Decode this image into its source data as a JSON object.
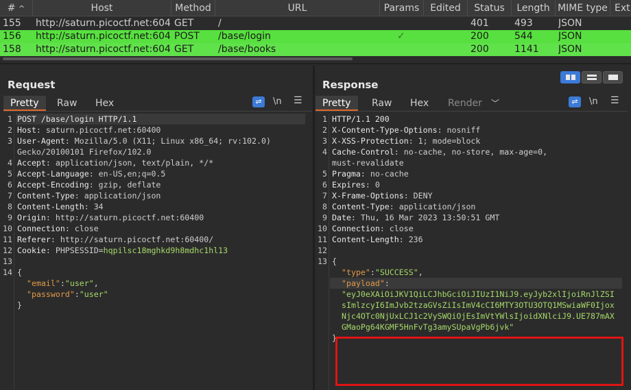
{
  "table": {
    "headers": [
      "#",
      "Host",
      "Method",
      "URL",
      "Params",
      "Edited",
      "Status",
      "Length",
      "MIME type",
      "Ext"
    ],
    "sort_indicator": "^",
    "rows": [
      {
        "num": "155",
        "host": "http://saturn.picoctf.net:604...",
        "method": "GET",
        "url": "/",
        "params": "",
        "status": "401",
        "length": "493",
        "mime": "JSON"
      },
      {
        "num": "156",
        "host": "http://saturn.picoctf.net:604...",
        "method": "POST",
        "url": "/base/login",
        "params": "✓",
        "status": "200",
        "length": "544",
        "mime": "JSON"
      },
      {
        "num": "158",
        "host": "http://saturn.picoctf.net:604...",
        "method": "GET",
        "url": "/base/books",
        "params": "",
        "status": "200",
        "length": "1141",
        "mime": "JSON"
      }
    ]
  },
  "request": {
    "title": "Request",
    "tabs": [
      "Pretty",
      "Raw",
      "Hex"
    ],
    "tool_newline": "\\n",
    "lines": [
      {
        "n": "1",
        "k": "POST /base/login HTTP/1.1",
        "v": ""
      },
      {
        "n": "2",
        "k": "Host",
        "v": ": saturn.picoctf.net:60400"
      },
      {
        "n": "3",
        "k": "User-Agent",
        "v": ": Mozilla/5.0 (X11; Linux x86_64; rv:102.0)"
      },
      {
        "n": "",
        "k": "",
        "v": "Gecko/20100101 Firefox/102.0"
      },
      {
        "n": "4",
        "k": "Accept",
        "v": ": application/json, text/plain, */*"
      },
      {
        "n": "5",
        "k": "Accept-Language",
        "v": ": en-US,en;q=0.5"
      },
      {
        "n": "6",
        "k": "Accept-Encoding",
        "v": ": gzip, deflate"
      },
      {
        "n": "7",
        "k": "Content-Type",
        "v": ": application/json"
      },
      {
        "n": "8",
        "k": "Content-Length",
        "v": ": 34"
      },
      {
        "n": "9",
        "k": "Origin",
        "v": ": http://saturn.picoctf.net:60400"
      },
      {
        "n": "10",
        "k": "Connection",
        "v": ": close"
      },
      {
        "n": "11",
        "k": "Referer",
        "v": ": http://saturn.picoctf.net:60400/"
      },
      {
        "n": "12",
        "k": "Cookie",
        "v": ": PHPSESSID="
      }
    ],
    "cookie_value": "hqpilsc18mghkd9h8mdhc1hl13",
    "line13": "13",
    "line14": "14",
    "brace_open": "{",
    "brace_close": "}",
    "json": [
      {
        "k": "\"email\"",
        "sep": ":",
        "v": "\"user\"",
        "end": ","
      },
      {
        "k": "\"password\"",
        "sep": ":",
        "v": "\"user\"",
        "end": ""
      }
    ]
  },
  "response": {
    "title": "Response",
    "tabs": [
      "Pretty",
      "Raw",
      "Hex",
      "Render"
    ],
    "tool_newline": "\\n",
    "lines": [
      {
        "n": "1",
        "k": "HTTP/1.1 200",
        "v": ""
      },
      {
        "n": "2",
        "k": "X-Content-Type-Options",
        "v": ": nosniff"
      },
      {
        "n": "3",
        "k": "X-XSS-Protection",
        "v": ": 1; mode=block"
      },
      {
        "n": "4",
        "k": "Cache-Control",
        "v": ": no-cache, no-store, max-age=0,"
      },
      {
        "n": "",
        "k": "",
        "v": "must-revalidate"
      },
      {
        "n": "5",
        "k": "Pragma",
        "v": ": no-cache"
      },
      {
        "n": "6",
        "k": "Expires",
        "v": ": 0"
      },
      {
        "n": "7",
        "k": "X-Frame-Options",
        "v": ": DENY"
      },
      {
        "n": "8",
        "k": "Content-Type",
        "v": ": application/json"
      },
      {
        "n": "9",
        "k": "Date",
        "v": ": Thu, 16 Mar 2023 13:50:51 GMT"
      },
      {
        "n": "10",
        "k": "Connection",
        "v": ": close"
      },
      {
        "n": "11",
        "k": "Content-Length",
        "v": ": 236"
      }
    ],
    "line12": "12",
    "line13": "13",
    "brace_open": "{",
    "brace_close": "}",
    "type_key": "\"type\"",
    "type_val": "\"SUCCESS\"",
    "payload_key": "\"payload\"",
    "payload_lines": [
      "\"eyJ0eXAiOiJKV1QiLCJhbGciOiJIUzI1NiJ9.eyJyb2xlIjoiRnJlZSI",
      "sImlzcyI6ImJvb2tzaGVsZiIsImV4cCI6MTY3OTU3OTQ1MSwiaWF0Ijox",
      "Njc4OTc0NjUxLCJ1c2VySWQiOjEsImVtYWlsIjoidXNlciJ9.UE787mAX",
      "GMaoPg64KGMF5HnFvTg3amySUpaVgPb6jvk\""
    ]
  }
}
